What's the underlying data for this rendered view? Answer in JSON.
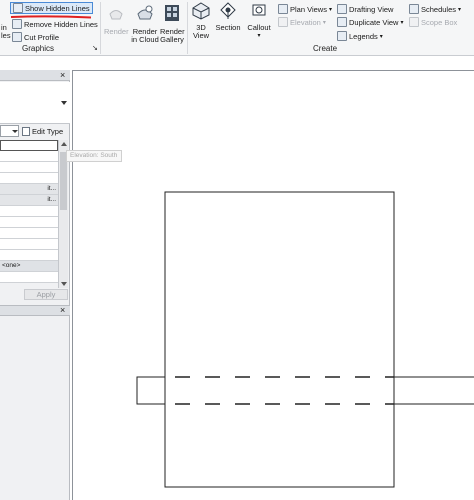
{
  "ribbon": {
    "left_truncated": [
      "in",
      "les"
    ],
    "graphics": {
      "show_hidden_lines": "Show  Hidden Lines",
      "remove_hidden_lines": "Remove  Hidden Lines",
      "cut_profile": "Cut  Profile",
      "group_label": "Graphics",
      "group_launcher": "↘"
    },
    "render": "Render",
    "render_in_cloud": [
      "Render",
      "in Cloud"
    ],
    "render_gallery": [
      "Render",
      "Gallery"
    ],
    "view_3d": [
      "3D",
      "View"
    ],
    "section": "Section",
    "callout": "Callout",
    "plan_views": "Plan  Views",
    "elevation": "Elevation",
    "drafting_view": "Drafting  View",
    "duplicate_view": "Duplicate  View",
    "legends": "Legends",
    "schedules": "Schedules",
    "scope_box": "Scope  Box",
    "create_label": "Create"
  },
  "properties": {
    "close": "×",
    "edit_type": "Edit Type",
    "rows": [
      "",
      "",
      "",
      "",
      "it...",
      "it...",
      "",
      "",
      "",
      "",
      "",
      "<one>",
      ""
    ],
    "apply": "Apply"
  },
  "project_browser": {
    "close": "×"
  },
  "tooltip": "Elevation: South",
  "colors": {
    "highlight_border": "#4a8ad6",
    "annotation_red": "#e02020"
  }
}
